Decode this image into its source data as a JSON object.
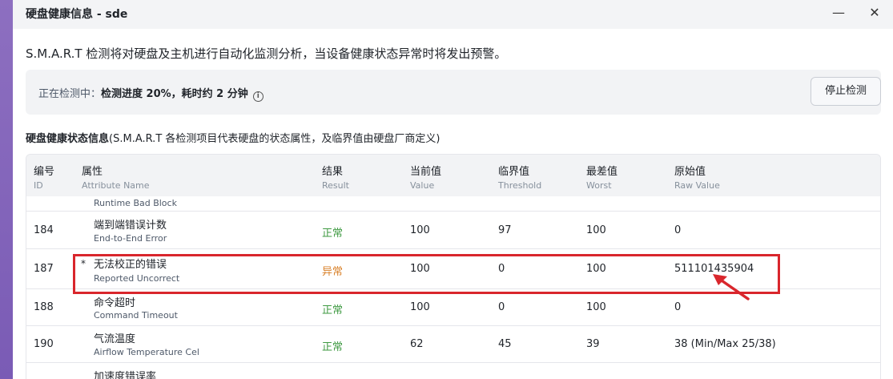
{
  "window": {
    "title": "硬盘健康信息 - sde",
    "minimize": "—",
    "close": "✕"
  },
  "description": "S.M.A.R.T 检测将对硬盘及主机进行自动化监测分析，当设备健康状态异常时将发出预警。",
  "status": {
    "prefix": "正在检测中：",
    "detail": "检测进度 20%，耗时约 2 分钟",
    "progress_percent": 20,
    "info_icon": "i",
    "stop_label": "停止检测"
  },
  "section": {
    "title": "硬盘健康状态信息",
    "note": "(S.M.A.R.T 各检测项目代表硬盘的状态属性，及临界值由硬盘厂商定义)"
  },
  "table": {
    "columns": [
      {
        "zh": "编号",
        "en": "ID"
      },
      {
        "zh": "属性",
        "en": "Attribute Name"
      },
      {
        "zh": "结果",
        "en": "Result"
      },
      {
        "zh": "当前值",
        "en": "Value"
      },
      {
        "zh": "临界值",
        "en": "Threshold"
      },
      {
        "zh": "最差值",
        "en": "Worst"
      },
      {
        "zh": "原始值",
        "en": "Raw Value"
      }
    ],
    "partial_top": {
      "attr_en": "Runtime Bad Block"
    },
    "rows": [
      {
        "id": "184",
        "attr_zh": "端到端错误计数",
        "attr_en": "End-to-End Error",
        "result": "正常",
        "value": "100",
        "threshold": "97",
        "worst": "100",
        "raw": "0",
        "marker": ""
      },
      {
        "id": "187",
        "attr_zh": "无法校正的错误",
        "attr_en": "Reported Uncorrect",
        "result": "异常",
        "value": "100",
        "threshold": "0",
        "worst": "100",
        "raw": "511101435904",
        "marker": "*"
      },
      {
        "id": "188",
        "attr_zh": "命令超时",
        "attr_en": "Command Timeout",
        "result": "正常",
        "value": "100",
        "threshold": "0",
        "worst": "100",
        "raw": "0",
        "marker": ""
      },
      {
        "id": "190",
        "attr_zh": "气流温度",
        "attr_en": "Airflow Temperature Cel",
        "result": "正常",
        "value": "62",
        "threshold": "45",
        "worst": "39",
        "raw": "38 (Min/Max 25/38)",
        "marker": ""
      }
    ],
    "partial_bottom": {
      "attr_zh": "加速度错误率"
    }
  },
  "colors": {
    "ok": "#3f9a42",
    "abnormal": "#d9822b",
    "highlight": "#d9262c"
  }
}
